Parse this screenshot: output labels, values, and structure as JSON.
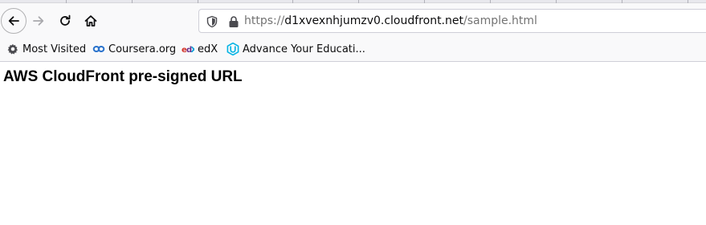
{
  "browser": {
    "url": {
      "scheme": "https://",
      "host": "d1xvexnhjumzv0.cloudfront.net",
      "path": "/sample.html"
    },
    "nav": {
      "back_icon": "arrow-left-icon",
      "forward_icon": "arrow-right-icon",
      "reload_icon": "reload-icon",
      "home_icon": "home-icon"
    },
    "bookmarks": [
      {
        "label": "Most Visited",
        "icon": "gear-icon"
      },
      {
        "label": "Coursera.org",
        "icon": "coursera-icon"
      },
      {
        "label": "edX",
        "icon": "edx-icon"
      },
      {
        "label": "Advance Your Educati...",
        "icon": "udacity-icon"
      }
    ],
    "colors": {
      "toolbar_bg": "#f9f9fa",
      "coursera_blue": "#2a73cc",
      "udacity_blue": "#02b3e4",
      "edx_red": "#d23228"
    }
  },
  "page": {
    "heading": "AWS CloudFront pre-signed URL"
  }
}
